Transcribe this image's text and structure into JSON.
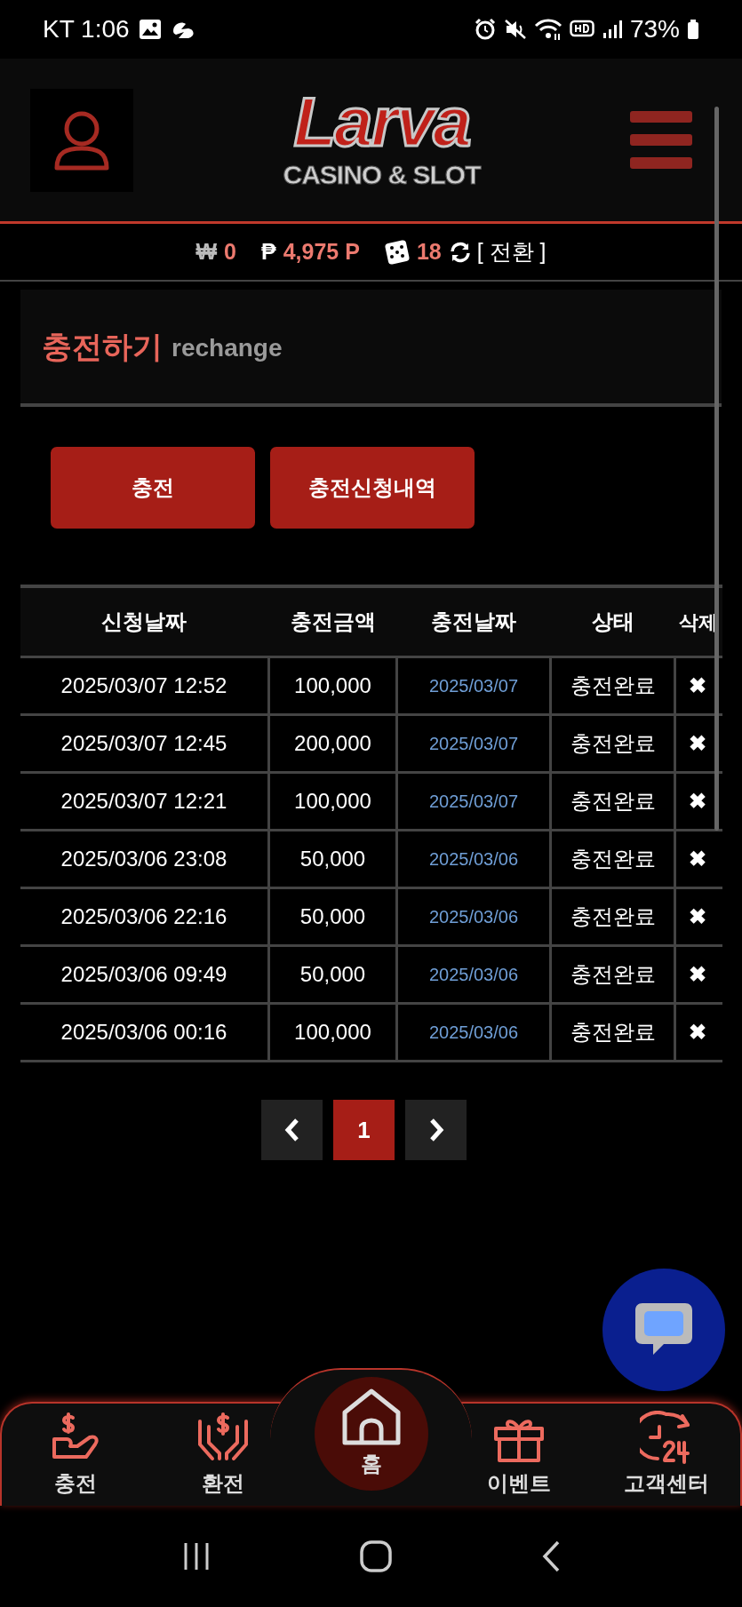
{
  "status_bar": {
    "carrier_time": "KT 1:06",
    "battery": "73%"
  },
  "header": {
    "logo_title": "Larva",
    "logo_subtitle": "CASINO & SLOT"
  },
  "balance": {
    "won_symbol": "₩",
    "won": "0",
    "point_symbol": "₱",
    "points": "4,975 P",
    "dice": "18",
    "switch": "[ 전환 ]"
  },
  "section": {
    "title": "충전하기",
    "subtitle": "rechange"
  },
  "buttons": [
    {
      "label": "충전"
    },
    {
      "label": "충전신청내역"
    }
  ],
  "table": {
    "columns": [
      "신청날짜",
      "충전금액",
      "충전날짜",
      "상태",
      "삭제"
    ],
    "rows": [
      {
        "requested": "2025/03/07 12:52",
        "amount": "100,000",
        "charged": "2025/03/07",
        "status": "충전완료",
        "delete": "✖"
      },
      {
        "requested": "2025/03/07 12:45",
        "amount": "200,000",
        "charged": "2025/03/07",
        "status": "충전완료",
        "delete": "✖"
      },
      {
        "requested": "2025/03/07 12:21",
        "amount": "100,000",
        "charged": "2025/03/07",
        "status": "충전완료",
        "delete": "✖"
      },
      {
        "requested": "2025/03/06 23:08",
        "amount": "50,000",
        "charged": "2025/03/06",
        "status": "충전완료",
        "delete": "✖"
      },
      {
        "requested": "2025/03/06 22:16",
        "amount": "50,000",
        "charged": "2025/03/06",
        "status": "충전완료",
        "delete": "✖"
      },
      {
        "requested": "2025/03/06 09:49",
        "amount": "50,000",
        "charged": "2025/03/06",
        "status": "충전완료",
        "delete": "✖"
      },
      {
        "requested": "2025/03/06 00:16",
        "amount": "100,000",
        "charged": "2025/03/06",
        "status": "충전완료",
        "delete": "✖"
      }
    ]
  },
  "pagination": {
    "pages": [
      {
        "label": "1",
        "selected": true
      }
    ]
  },
  "bottom_nav": [
    {
      "kind": "charge",
      "label": "충전"
    },
    {
      "kind": "exchange",
      "label": "환전"
    },
    {
      "kind": "home",
      "label": "홈"
    },
    {
      "kind": "event",
      "label": "이벤트"
    },
    {
      "kind": "support",
      "label": "고객센터"
    }
  ]
}
